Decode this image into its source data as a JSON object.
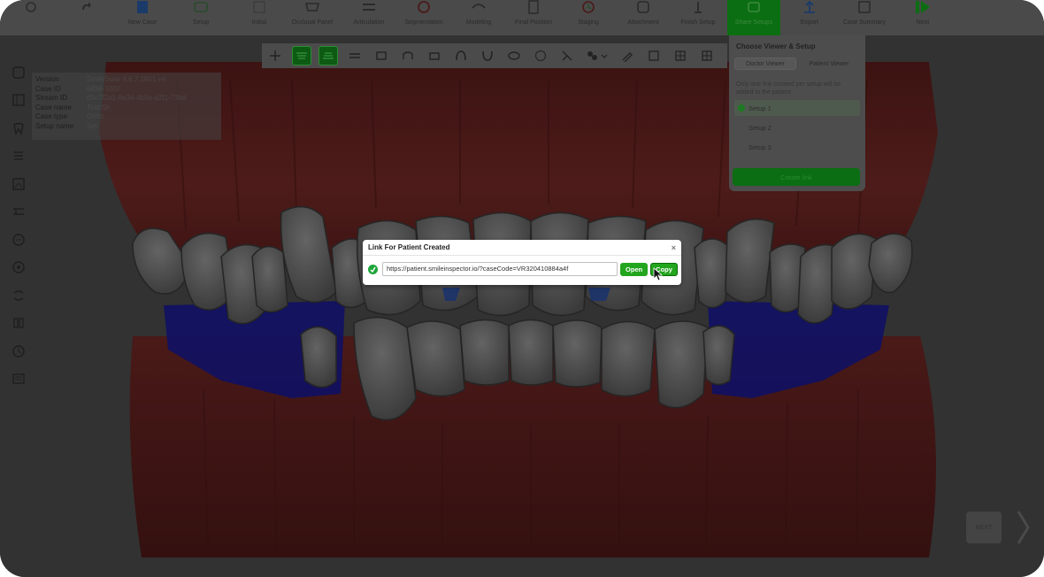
{
  "toolbar": {
    "items": [
      {
        "label": "",
        "icon": "home-icon"
      },
      {
        "label": "",
        "icon": "redo-icon"
      },
      {
        "label": "New Case",
        "icon": "new-case-icon"
      },
      {
        "label": "Setup",
        "icon": "setup-icon"
      },
      {
        "label": "Initial",
        "icon": "initial-icon"
      },
      {
        "label": "Occlusal Panel",
        "icon": "occlusal-icon"
      },
      {
        "label": "Articulation",
        "icon": "articulation-icon"
      },
      {
        "label": "Segmentation",
        "icon": "segmentation-icon"
      },
      {
        "label": "Modeling",
        "icon": "modeling-icon"
      },
      {
        "label": "Final Position",
        "icon": "final-position-icon"
      },
      {
        "label": "Staging",
        "icon": "staging-icon"
      },
      {
        "label": "Attachment",
        "icon": "attachment-icon"
      },
      {
        "label": "Finish Setup",
        "icon": "finish-setup-icon"
      },
      {
        "label": "Share Setups",
        "icon": "share-icon"
      },
      {
        "label": "Export",
        "icon": "export-icon"
      },
      {
        "label": "Case Summary",
        "icon": "summary-icon"
      },
      {
        "label": "Next",
        "icon": "next-icon"
      }
    ],
    "active_label": "Share Setups"
  },
  "info": {
    "rows": [
      {
        "key": "Version",
        "value": "SmileSuite 4.6.7.1801-rel"
      },
      {
        "key": "Case ID",
        "value": "6836-1007"
      },
      {
        "key": "Stream ID",
        "value": "d5c7f2a1-8e34-4b9a-a2f1-73bd"
      },
      {
        "key": "Case name",
        "value": "Test Sh"
      },
      {
        "key": "Case type",
        "value": "Ortho"
      },
      {
        "key": "Setup name",
        "value": "Set"
      }
    ]
  },
  "setup_panel": {
    "title": "Choose Viewer & Setup",
    "tabs": [
      "Doctor Viewer",
      "Patient Viewer"
    ],
    "note": "Only one link created per setup will be added to the patient",
    "options": [
      "Setup 1",
      "Setup 2",
      "Setup 3"
    ],
    "selected": "Setup 1",
    "create_button": "Create link"
  },
  "modal": {
    "title": "Link For Patient Created",
    "close": "×",
    "url": "https://patient.smileinspector.io/?caseCode=VR320410884a4f",
    "open_button": "Open",
    "copy_button": "Copy"
  },
  "next_button": "NEXT",
  "colors": {
    "accent_green": "#23a51d",
    "active_tab_green": "#0c6e12",
    "gum_red": "#5a201e",
    "tooth_gray": "#5e5e5e",
    "bracket_blue": "#14147a"
  }
}
